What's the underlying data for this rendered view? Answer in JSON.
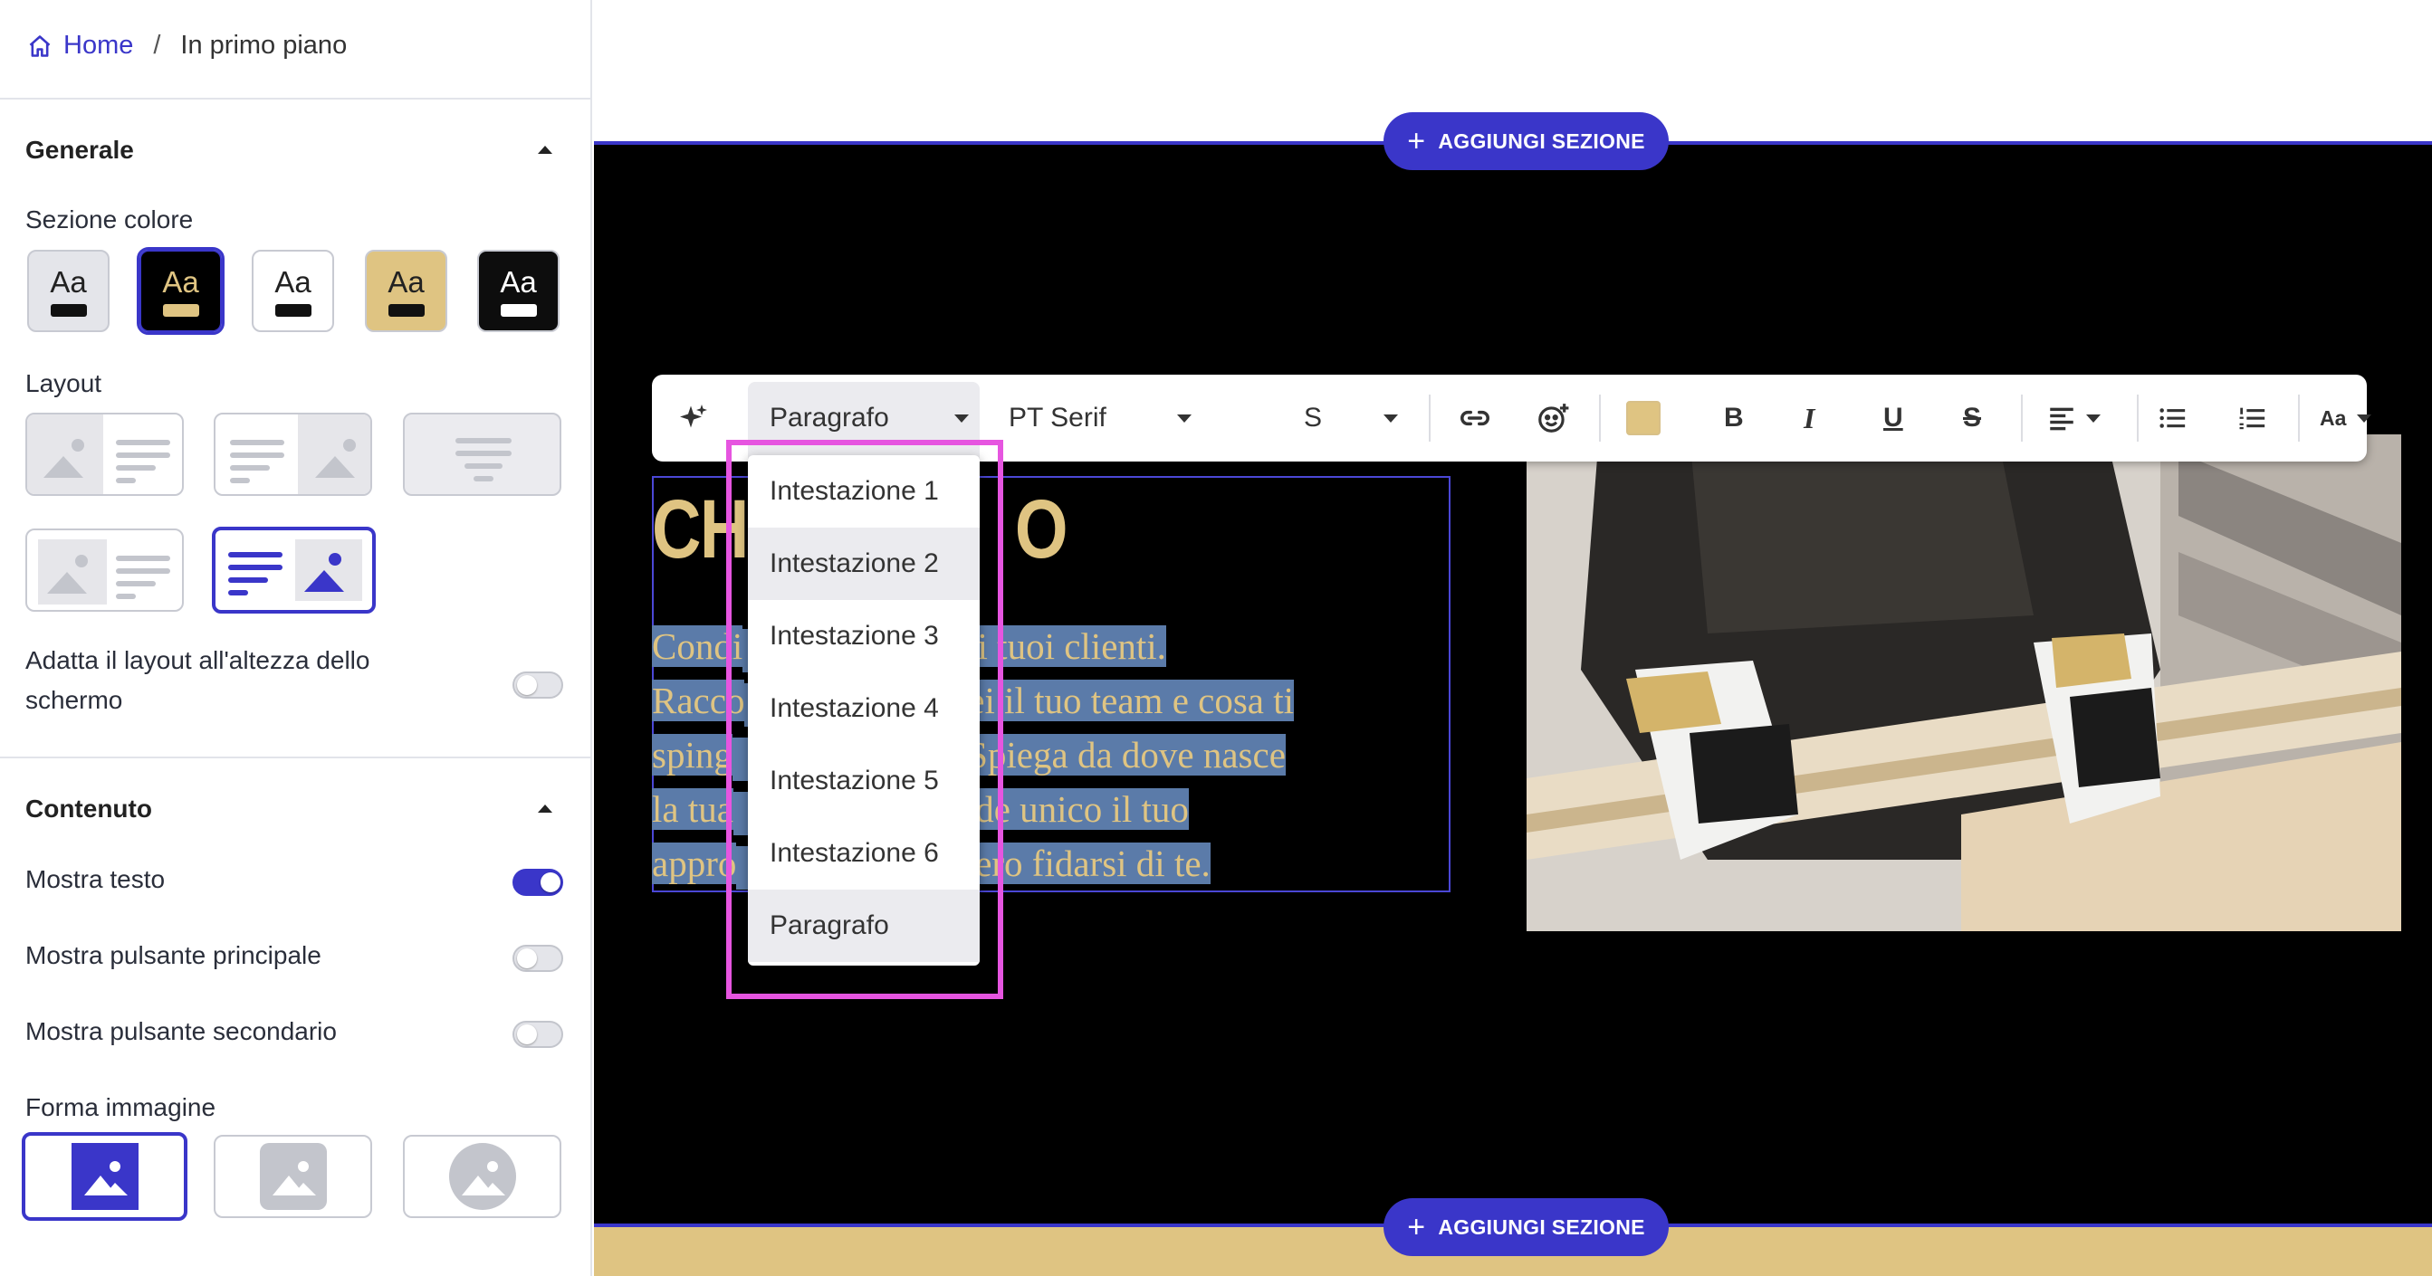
{
  "breadcrumb": {
    "home": "Home",
    "separator": "/",
    "current": "In primo piano"
  },
  "sidebar": {
    "general": {
      "title": "Generale",
      "color_label": "Sezione colore",
      "swatches": [
        {
          "text": "Aa",
          "bg": "#e4e5ea",
          "fg": "#222222",
          "bar": "#111111",
          "selected": false
        },
        {
          "text": "Aa",
          "bg": "#000000",
          "fg": "#dfc482",
          "bar": "#dfc482",
          "selected": true
        },
        {
          "text": "Aa",
          "bg": "#ffffff",
          "fg": "#222222",
          "bar": "#111111",
          "selected": false
        },
        {
          "text": "Aa",
          "bg": "#dfc482",
          "fg": "#222222",
          "bar": "#111111",
          "selected": false
        },
        {
          "text": "Aa",
          "bg": "#0d0d0d",
          "fg": "#ffffff",
          "bar": "#ffffff",
          "selected": false
        }
      ],
      "layout_label": "Layout",
      "fit_label": "Adatta il layout all'altezza dello schermo",
      "fit_on": false
    },
    "content": {
      "title": "Contenuto",
      "show_text": "Mostra testo",
      "show_text_on": true,
      "show_primary": "Mostra pulsante principale",
      "show_primary_on": false,
      "show_secondary": "Mostra pulsante secondario",
      "show_secondary_on": false,
      "image_shape": "Forma immagine"
    }
  },
  "canvas": {
    "add_section": "AGGIUNGI SEZIONE",
    "headline": "CHI SIAMO",
    "headline_visible_left": "CH",
    "headline_visible_right": "O",
    "paragraph_lines": [
      [
        "Condi",
        "ia con i tuoi clienti."
      ],
      [
        "Racco",
        ", chi sei il tuo team e cosa ti"
      ],
      [
        "sping",
        "renza. Spiega da dove nasce"
      ],
      [
        "la tua",
        "osa rende unico il tuo"
      ],
      [
        "appro",
        "ovrebbero fidarsi di te."
      ]
    ]
  },
  "toolbar": {
    "block_type": "Paragrafo",
    "font": "PT Serif",
    "size": "S",
    "text_color": "#dfc482",
    "bold": "B",
    "italic": "I",
    "underline": "U",
    "strike": "S",
    "case": "Aa"
  },
  "dropdown": {
    "options": [
      "Intestazione 1",
      "Intestazione 2",
      "Intestazione 3",
      "Intestazione 4",
      "Intestazione 5",
      "Intestazione 6",
      "Paragrafo"
    ],
    "hovered": "Intestazione 2",
    "selected": "Paragrafo"
  },
  "colors": {
    "accent": "#3a36c9",
    "gold": "#dfc482",
    "highlight": "#e655e0"
  }
}
